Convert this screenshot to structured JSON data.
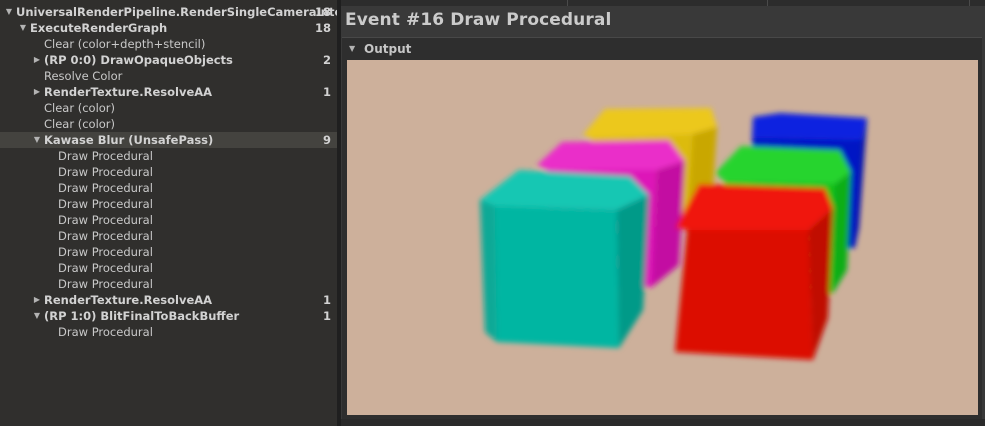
{
  "tree": {
    "rows": [
      {
        "label": "UniversalRenderPipeline.RenderSingleCameraInter",
        "count": "18",
        "expander": "expanded",
        "level": 0,
        "bold": true,
        "selected": false
      },
      {
        "label": "ExecuteRenderGraph",
        "count": "18",
        "expander": "expanded",
        "level": 1,
        "bold": true,
        "selected": false
      },
      {
        "label": "Clear (color+depth+stencil)",
        "count": "",
        "expander": "none",
        "level": 2,
        "bold": false,
        "selected": false
      },
      {
        "label": "(RP 0:0) DrawOpaqueObjects",
        "count": "2",
        "expander": "collapsed",
        "level": 2,
        "bold": true,
        "selected": false
      },
      {
        "label": "Resolve Color",
        "count": "",
        "expander": "none",
        "level": 2,
        "bold": false,
        "selected": false
      },
      {
        "label": "RenderTexture.ResolveAA",
        "count": "1",
        "expander": "collapsed",
        "level": 2,
        "bold": true,
        "selected": false
      },
      {
        "label": "Clear (color)",
        "count": "",
        "expander": "none",
        "level": 2,
        "bold": false,
        "selected": false
      },
      {
        "label": "Clear (color)",
        "count": "",
        "expander": "none",
        "level": 2,
        "bold": false,
        "selected": false
      },
      {
        "label": "Kawase Blur (UnsafePass)",
        "count": "9",
        "expander": "expanded",
        "level": 2,
        "bold": true,
        "selected": true
      },
      {
        "label": "Draw Procedural",
        "count": "",
        "expander": "none",
        "level": 3,
        "bold": false,
        "selected": false
      },
      {
        "label": "Draw Procedural",
        "count": "",
        "expander": "none",
        "level": 3,
        "bold": false,
        "selected": false
      },
      {
        "label": "Draw Procedural",
        "count": "",
        "expander": "none",
        "level": 3,
        "bold": false,
        "selected": false
      },
      {
        "label": "Draw Procedural",
        "count": "",
        "expander": "none",
        "level": 3,
        "bold": false,
        "selected": false
      },
      {
        "label": "Draw Procedural",
        "count": "",
        "expander": "none",
        "level": 3,
        "bold": false,
        "selected": false
      },
      {
        "label": "Draw Procedural",
        "count": "",
        "expander": "none",
        "level": 3,
        "bold": false,
        "selected": false
      },
      {
        "label": "Draw Procedural",
        "count": "",
        "expander": "none",
        "level": 3,
        "bold": false,
        "selected": false
      },
      {
        "label": "Draw Procedural",
        "count": "",
        "expander": "none",
        "level": 3,
        "bold": false,
        "selected": false
      },
      {
        "label": "Draw Procedural",
        "count": "",
        "expander": "none",
        "level": 3,
        "bold": false,
        "selected": false
      },
      {
        "label": "RenderTexture.ResolveAA",
        "count": "1",
        "expander": "collapsed",
        "level": 2,
        "bold": true,
        "selected": false
      },
      {
        "label": "(RP 1:0) BlitFinalToBackBuffer",
        "count": "1",
        "expander": "expanded",
        "level": 2,
        "bold": true,
        "selected": false
      },
      {
        "label": "Draw Procedural",
        "count": "",
        "expander": "none",
        "level": 3,
        "bold": false,
        "selected": false
      }
    ],
    "icons": {
      "expanded": "triangle-down-icon",
      "collapsed": "triangle-right-icon"
    }
  },
  "detail": {
    "event_title": "Event #16 Draw Procedural",
    "output_section": {
      "label": "Output",
      "icon": "triangle-down-icon"
    }
  },
  "render_preview": {
    "description_colors": {
      "background": "#cdb09b",
      "teal_cube": "#00b6a2",
      "magenta_cube": "#dd13b8",
      "yellow_cube": "#dcbb08",
      "blue_cube": "#0517c4",
      "green_cube": "#13c319",
      "red_cube": "#dc0a05"
    }
  }
}
